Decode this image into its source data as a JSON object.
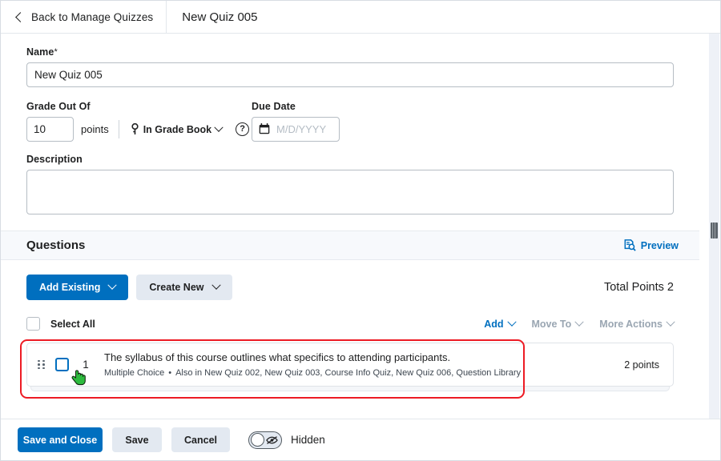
{
  "topbar": {
    "back_label": "Back to Manage Quizzes",
    "back_icon": "chevron-left-icon",
    "quiz_title": "New Quiz 005"
  },
  "form": {
    "name_label": "Name",
    "name_required_marker": "*",
    "name_value": "New Quiz 005",
    "grade_out_of_label": "Grade Out Of",
    "grade_out_of_value": "10",
    "points_label": "points",
    "grade_book_label": "In Grade Book",
    "grade_book_icon": "pin-icon",
    "help_icon_label": "?",
    "due_date_label": "Due Date",
    "due_date_value": "",
    "due_date_placeholder": "M/D/YYYY",
    "due_date_icon": "calendar-icon",
    "description_label": "Description",
    "description_value": ""
  },
  "questions": {
    "section_title": "Questions",
    "preview_label": "Preview",
    "preview_icon": "page-search-icon",
    "add_existing_label": "Add Existing",
    "create_new_label": "Create New",
    "total_points_label": "Total Points 2",
    "select_all_label": "Select All",
    "menus": [
      {
        "label": "Add",
        "state": "active"
      },
      {
        "label": "Move To",
        "state": "disabled"
      },
      {
        "label": "More Actions",
        "state": "disabled"
      }
    ],
    "rows": [
      {
        "number": "1",
        "title": "The syllabus of this course outlines what specifics to attending participants.",
        "type": "Multiple Choice",
        "separator": "•",
        "also_in": "Also in New Quiz 002, New Quiz 003, Course Info Quiz, New Quiz 006, Question Library",
        "points": "2 points",
        "drag_icon": "drag-handle-icon"
      }
    ]
  },
  "bottombar": {
    "save_and_close_label": "Save and Close",
    "save_label": "Save",
    "cancel_label": "Cancel",
    "visibility_label": "Hidden",
    "visibility_icon": "eye-slash-icon"
  },
  "annotation": {
    "highlight_color": "#ed1b24",
    "cursor_icon": "green-hand-cursor"
  },
  "colors": {
    "primary_blue": "#006fbf",
    "secondary_grey": "#e3e9f1",
    "band_grey": "#f7f9fc",
    "disabled_text": "#9aa6b2",
    "highlight_red": "#ed1b24"
  }
}
